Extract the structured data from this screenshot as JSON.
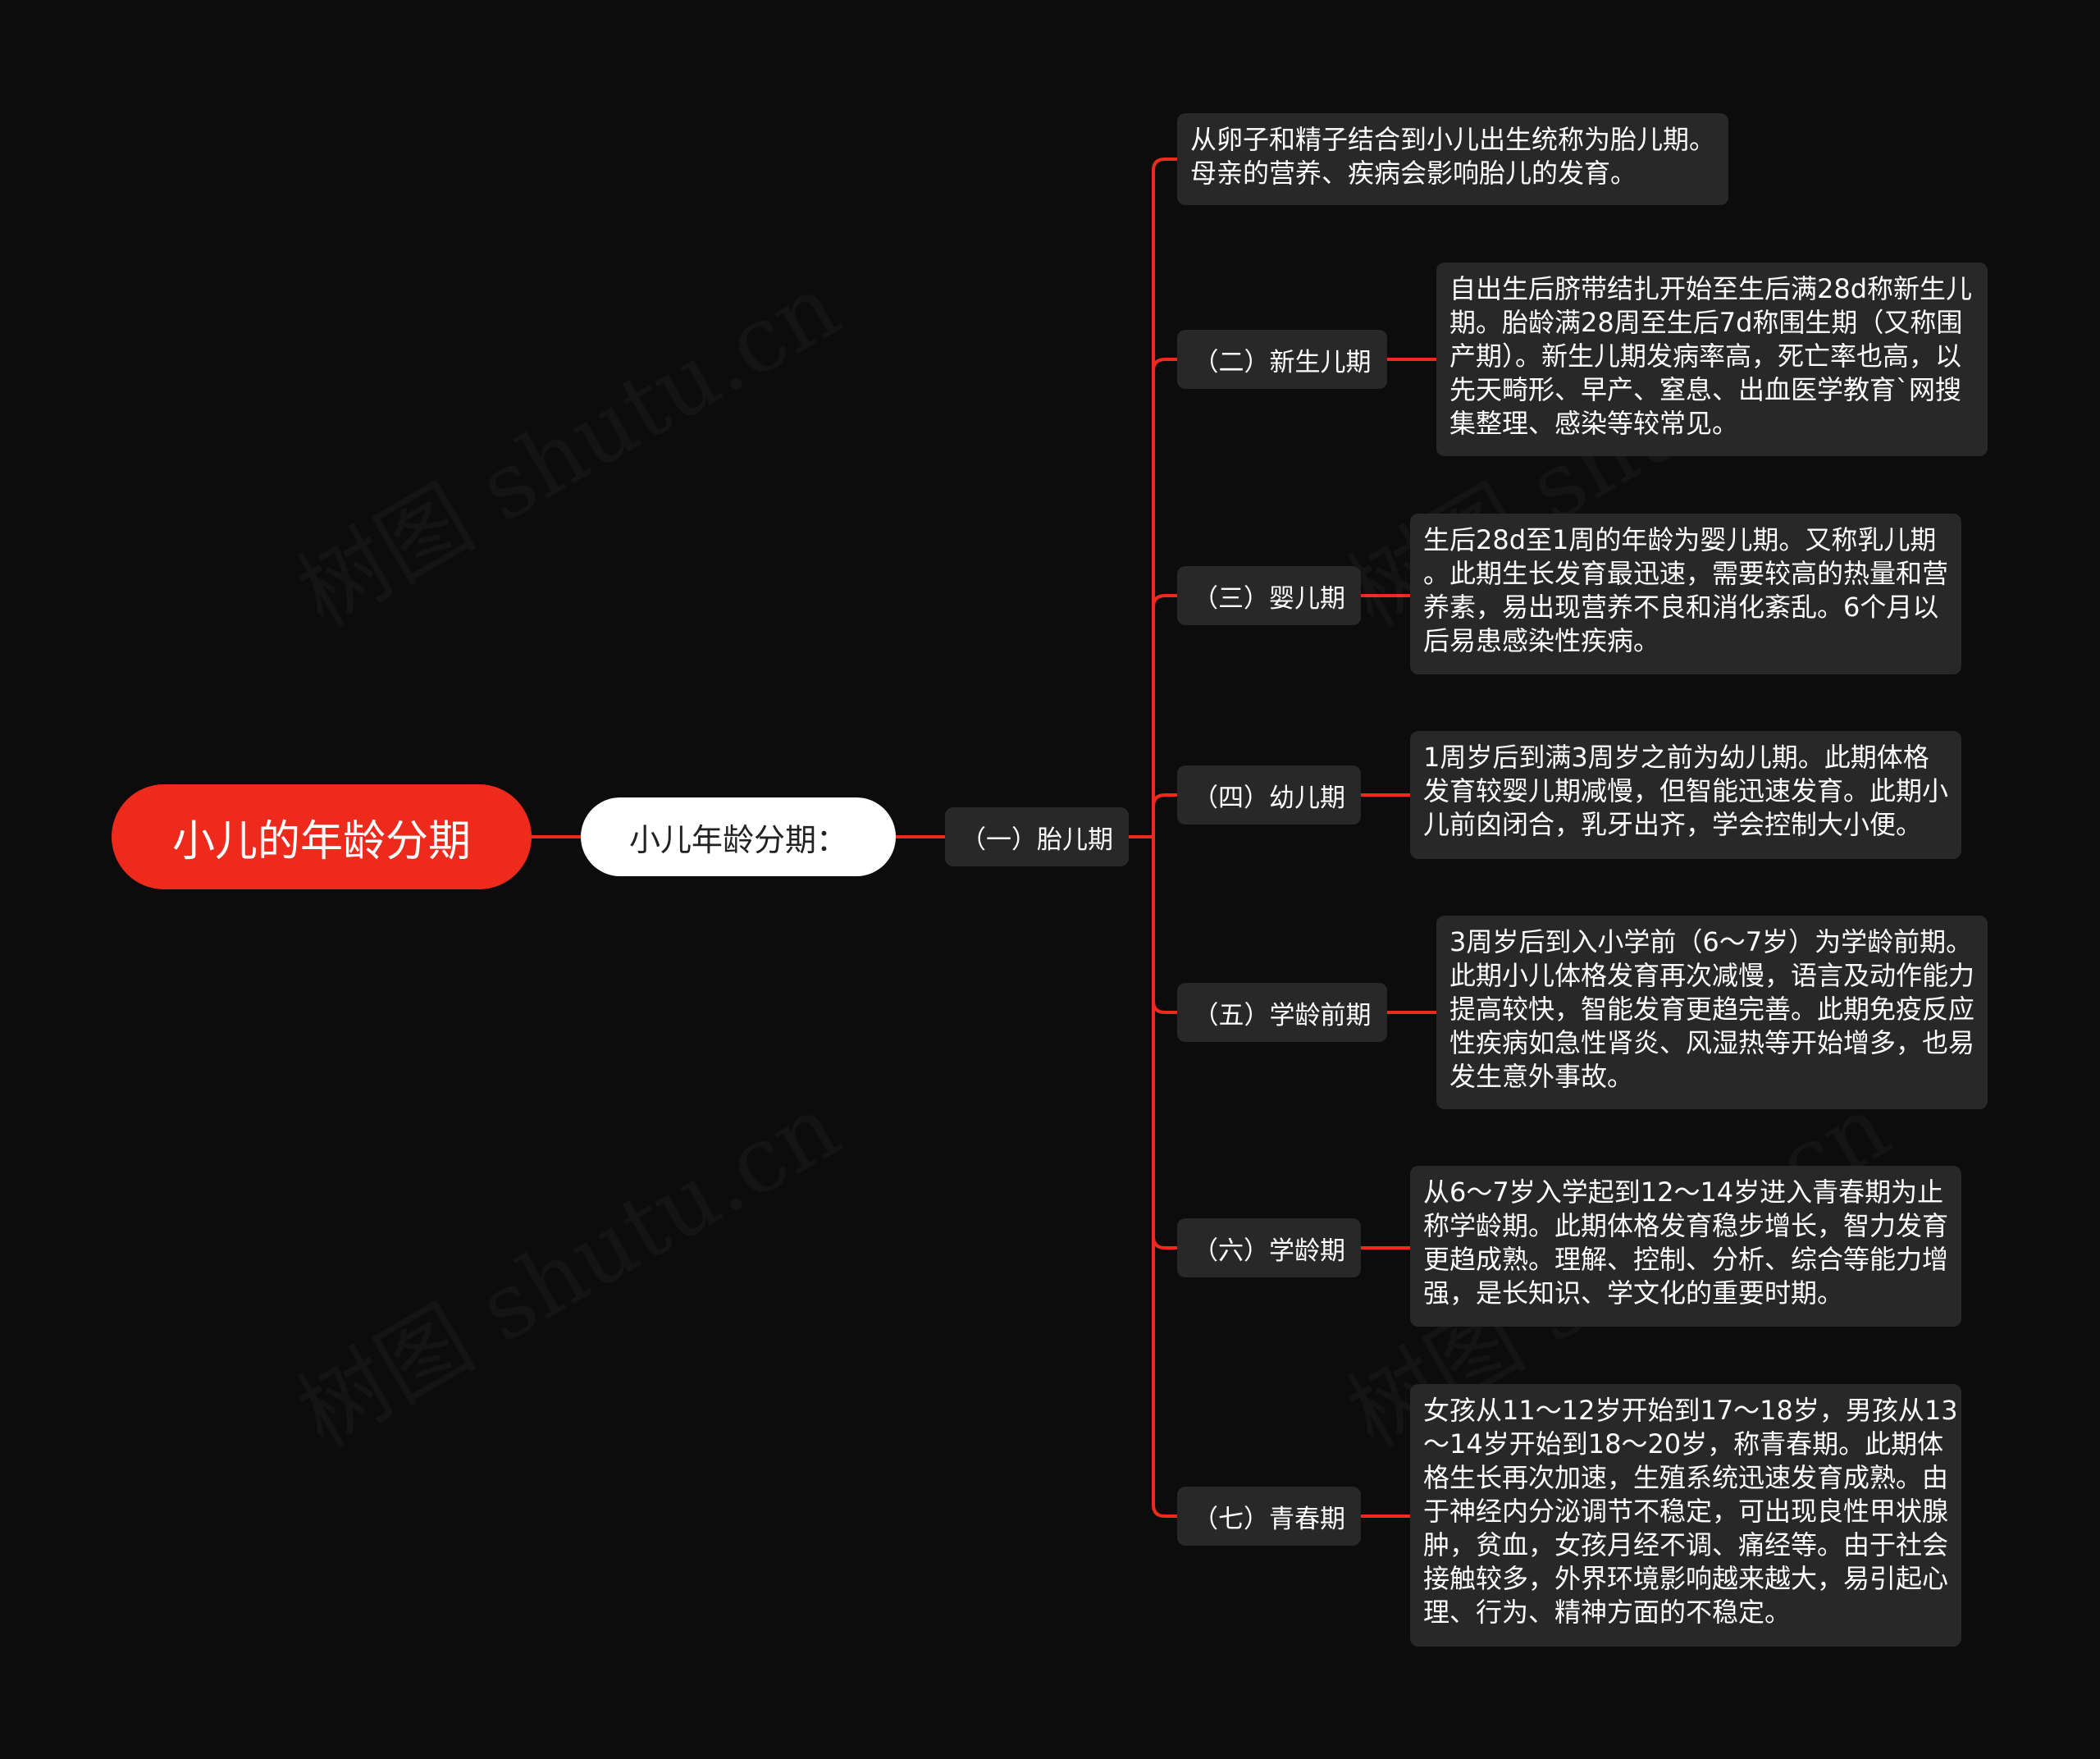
{
  "watermark": "树图 shutu.cn",
  "colors": {
    "background": "#0c0c0c",
    "root": "#ee2a1c",
    "connector": "#ee2a1c",
    "node_fill": "#282828",
    "level1_fill": "#ffffff"
  },
  "root": {
    "label": "小儿的年龄分期"
  },
  "level1": {
    "label": "小儿年龄分期："
  },
  "first_period": {
    "label": "（一）胎儿期",
    "desc": [
      "从卵子和精子结合到小儿出生统称为胎儿期。",
      "母亲的营养、疾病会影响胎儿的发育。"
    ]
  },
  "periods": [
    {
      "label": "（二）新生儿期",
      "desc": [
        "自出生后脐带结扎开始至生后满28d称新生儿",
        "期。胎龄满28周至生后7d称围生期（又称围",
        "产期）。新生儿期发病率高，死亡率也高，以",
        "先天畸形、早产、窒息、出血医学教育`网搜",
        "集整理、感染等较常见。"
      ]
    },
    {
      "label": "（三）婴儿期",
      "desc": [
        "生后28d至1周的年龄为婴儿期。又称乳儿期",
        "。此期生长发育最迅速，需要较高的热量和营",
        "养素，易出现营养不良和消化紊乱。6个月以",
        "后易患感染性疾病。"
      ]
    },
    {
      "label": "（四）幼儿期",
      "desc": [
        "1周岁后到满3周岁之前为幼儿期。此期体格",
        "发育较婴儿期减慢，但智能迅速发育。此期小",
        "儿前囟闭合，乳牙出齐，学会控制大小便。"
      ]
    },
    {
      "label": "（五）学龄前期",
      "desc": [
        "3周岁后到入小学前（6～7岁）为学龄前期。",
        "此期小儿体格发育再次减慢，语言及动作能力",
        "提高较快，智能发育更趋完善。此期免疫反应",
        "性疾病如急性肾炎、风湿热等开始增多，也易",
        "发生意外事故。"
      ]
    },
    {
      "label": "（六）学龄期",
      "desc": [
        "从6～7岁入学起到12～14岁进入青春期为止",
        "称学龄期。此期体格发育稳步增长，智力发育",
        "更趋成熟。理解、控制、分析、综合等能力增",
        "强，是长知识、学文化的重要时期。"
      ]
    },
    {
      "label": "（七）青春期",
      "desc": [
        "女孩从11～12岁开始到17～18岁，男孩从13",
        "～14岁开始到18～20岁，称青春期。此期体",
        "格生长再次加速，生殖系统迅速发育成熟。由",
        "于神经内分泌调节不稳定，可出现良性甲状腺",
        "肿，贫血，女孩月经不调、痛经等。由于社会",
        "接触较多，外界环境影响越来越大，易引起心",
        "理、行为、精神方面的不稳定。"
      ]
    }
  ]
}
